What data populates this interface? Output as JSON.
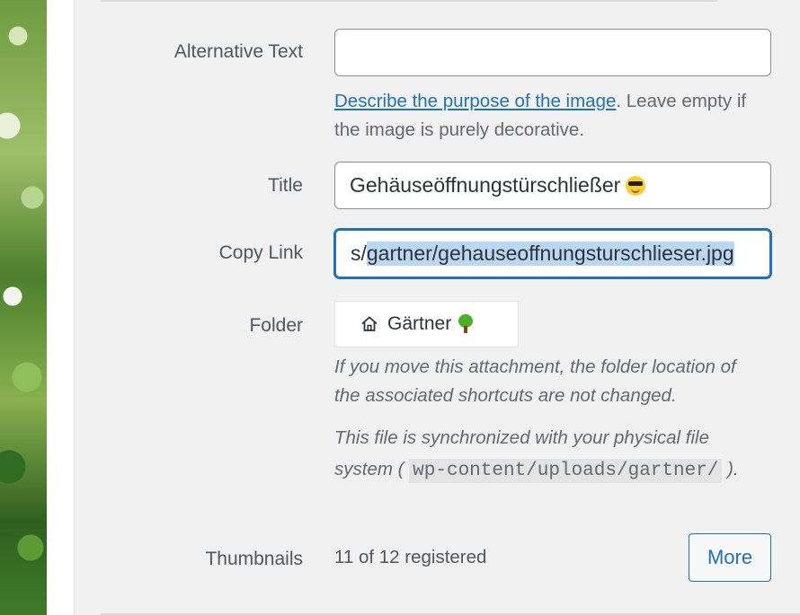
{
  "attachment_details": {
    "alt_text": {
      "label": "Alternative Text",
      "value": ""
    },
    "alt_help": {
      "link_text": "Describe the purpose of the image",
      "text": ". Leave empty if the image is purely decorative."
    },
    "title": {
      "label": "Title",
      "value": "Gehäuseöffnungstürschließer"
    },
    "title_emoji": "smiling-face-with-sunglasses",
    "copy_link": {
      "label": "Copy Link",
      "value_before_selection": "s/",
      "selected_text": "gartner/gehauseoffnungsturschlieser.jpg"
    },
    "folder": {
      "label": "Folder",
      "name": "Gärtner",
      "icon": "home-icon",
      "emoji": "deciduous-tree",
      "note": "If you move this attachment, the folder location of the associated shortcuts are not changed.",
      "sync_prefix": "This file is synchronized with your physical file system (",
      "sync_path": "wp-content/uploads/gartner/",
      "sync_suffix": ")."
    },
    "thumbnails": {
      "label": "Thumbnails",
      "value": "11 of 12 registered",
      "button": "More"
    }
  },
  "colors": {
    "link": "#2271b1",
    "focus": "#2271b1",
    "selection": "#bcd7f3"
  }
}
